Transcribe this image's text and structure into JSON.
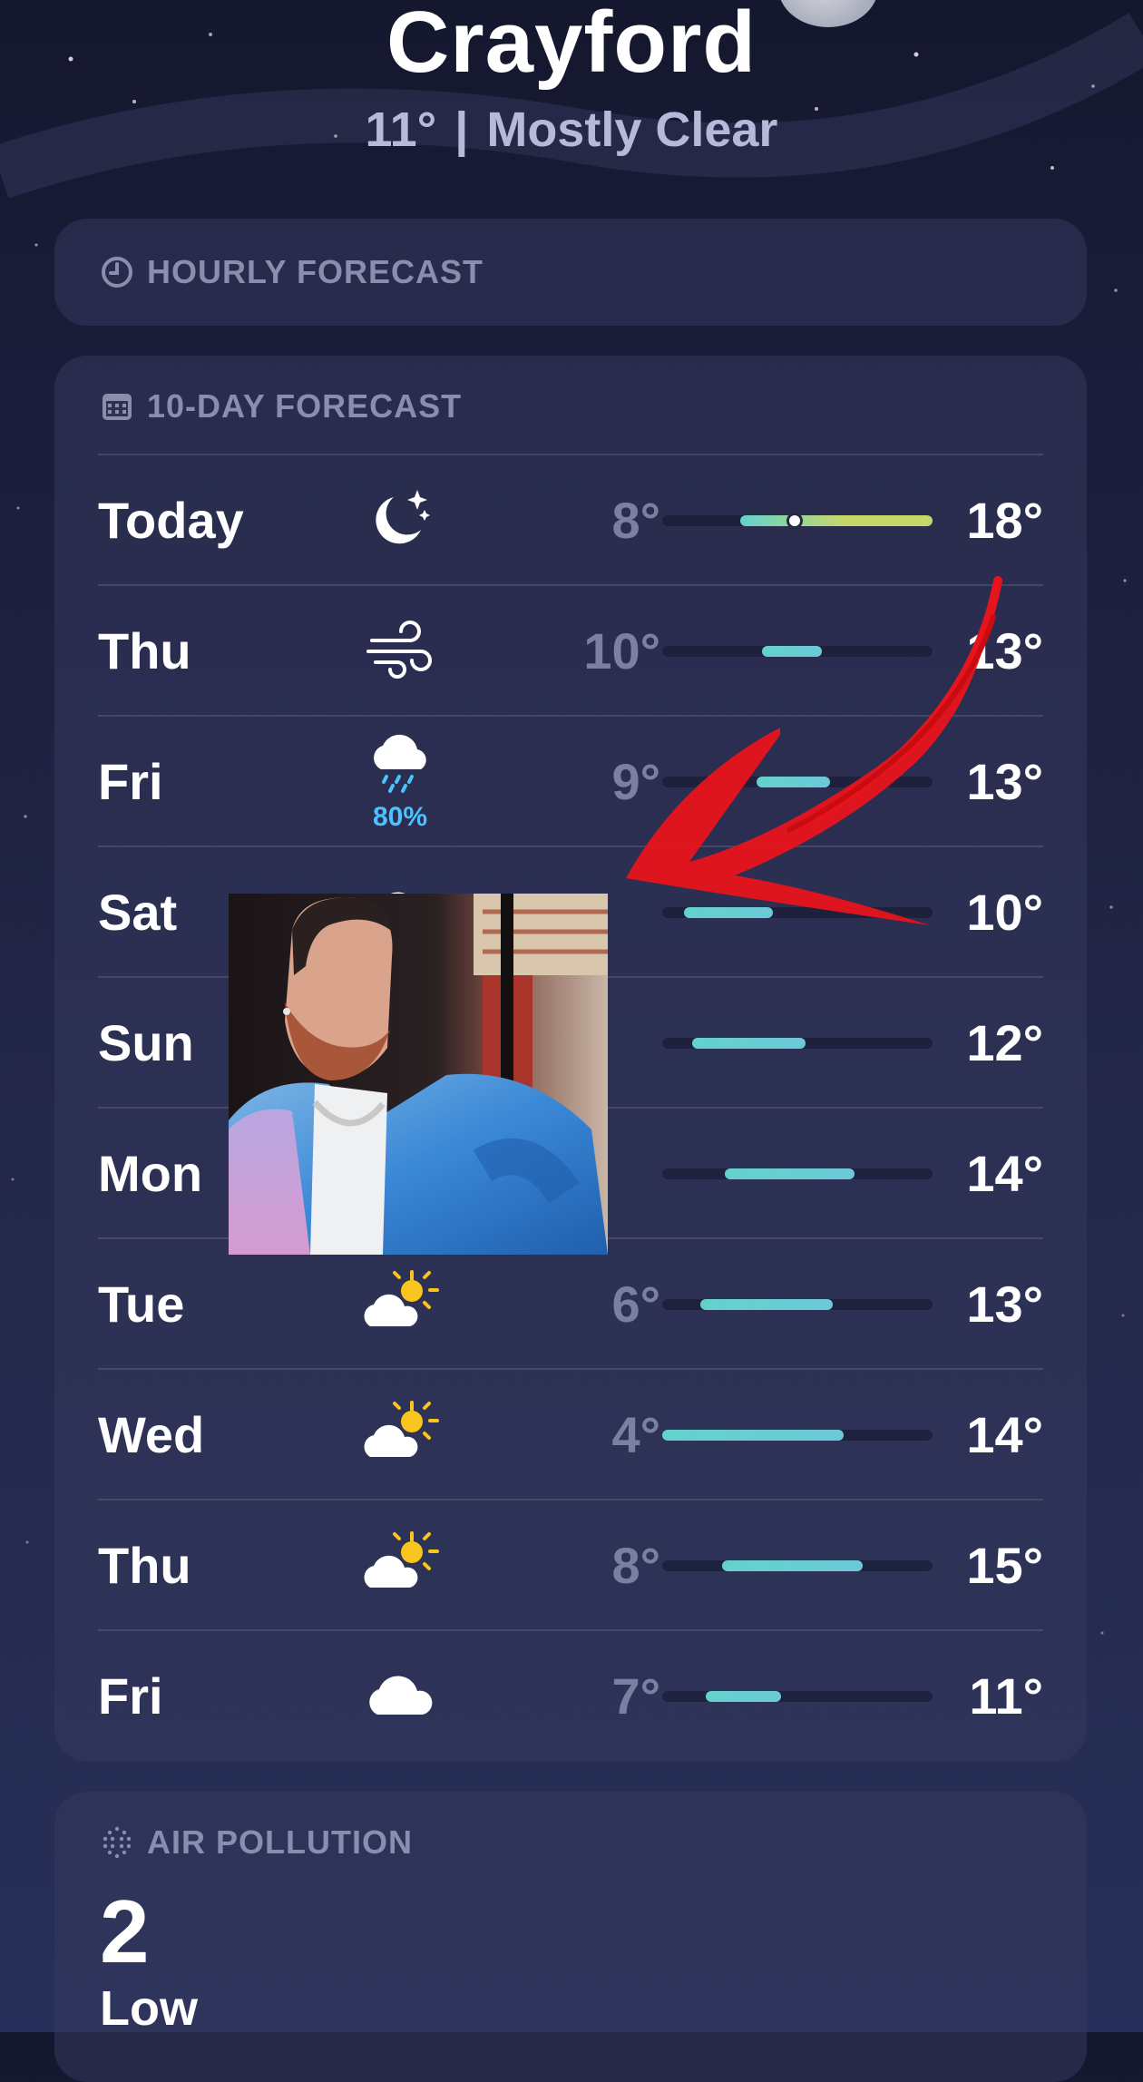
{
  "location": {
    "city": "Crayford",
    "current_temp": "11°",
    "separator": "|",
    "condition": "Mostly Clear"
  },
  "hourly": {
    "title": "HOURLY FORECAST",
    "icon": "clock-icon"
  },
  "ten_day": {
    "title": "10-DAY FORECAST",
    "icon": "calendar-icon",
    "days": [
      {
        "day": "Today",
        "icon": "moon-stars-icon",
        "low": "8°",
        "high": "18°",
        "bar_start": 0.29,
        "bar_end": 1.0,
        "current_marker": 0.49,
        "gradient": "warm"
      },
      {
        "day": "Thu",
        "icon": "wind-icon",
        "low": "10°",
        "high": "13°",
        "bar_start": 0.37,
        "bar_end": 0.59
      },
      {
        "day": "Fri",
        "icon": "cloud-rain-icon",
        "precip": "80%",
        "low": "9°",
        "high": "13°",
        "bar_start": 0.35,
        "bar_end": 0.62
      },
      {
        "day": "Sat",
        "icon": "cloud-icon",
        "low": "",
        "high": "10°",
        "bar_start": 0.08,
        "bar_end": 0.41
      },
      {
        "day": "Sun",
        "icon": "cloud-icon",
        "low": "",
        "high": "12°",
        "bar_start": 0.11,
        "bar_end": 0.53
      },
      {
        "day": "Mon",
        "icon": "cloud-icon",
        "low": "",
        "high": "14°",
        "bar_start": 0.23,
        "bar_end": 0.71
      },
      {
        "day": "Tue",
        "icon": "partly-sunny-icon",
        "low": "6°",
        "high": "13°",
        "bar_start": 0.14,
        "bar_end": 0.63
      },
      {
        "day": "Wed",
        "icon": "partly-sunny-icon",
        "low": "4°",
        "high": "14°",
        "bar_start": 0.0,
        "bar_end": 0.67
      },
      {
        "day": "Thu",
        "icon": "partly-sunny-icon",
        "low": "8°",
        "high": "15°",
        "bar_start": 0.22,
        "bar_end": 0.74
      },
      {
        "day": "Fri",
        "icon": "cloud-icon",
        "low": "7°",
        "high": "11°",
        "bar_start": 0.16,
        "bar_end": 0.44
      }
    ]
  },
  "air_pollution": {
    "title": "AIR POLLUTION",
    "icon": "air-dots-icon",
    "value": "2",
    "label": "Low"
  },
  "overlay": {
    "photo": "man-in-blue-puffer-jacket-photo",
    "arrow_color": "#e8141b"
  },
  "colors": {
    "bar_cool": "#63d2cc",
    "bar_warm": "#c8d76a",
    "precip": "#4cc3ff",
    "sun": "#f8c51e"
  }
}
